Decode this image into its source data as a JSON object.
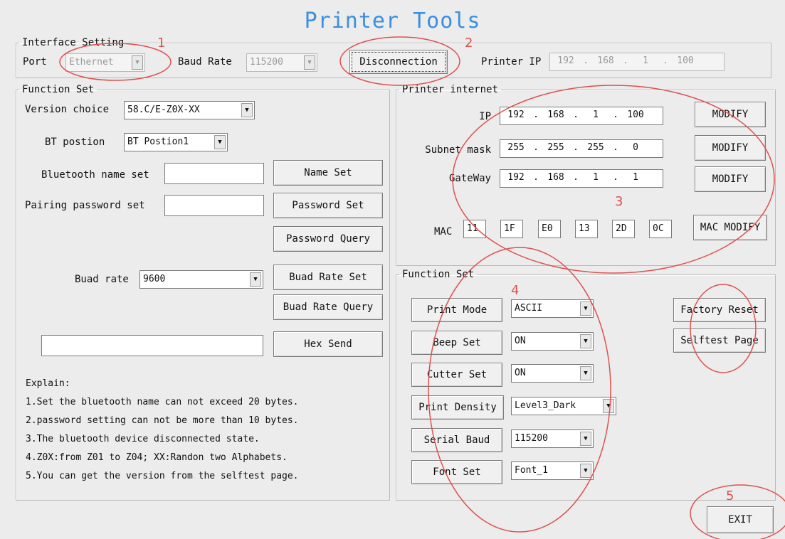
{
  "window_title": "Printer Tools",
  "interface": {
    "legend": "Interface Setting",
    "port_label": "Port",
    "port_value": "Ethernet",
    "baud_label": "Baud Rate",
    "baud_value": "115200",
    "disconnect_label": "Disconnection",
    "printer_ip_label": "Printer IP",
    "printer_ip": [
      "192",
      "168",
      "1",
      "100"
    ]
  },
  "function_left": {
    "legend": "Function Set",
    "version_label": "Version choice",
    "version_value": "58.C/E-Z0X-XX",
    "bt_label": "BT postion",
    "bt_value": "BT Postion1",
    "bt_name_label": "Bluetooth name set",
    "bt_name_value": "",
    "name_set_button": "Name Set",
    "pair_label": "Pairing password set",
    "pair_value": "",
    "password_set_button": "Password Set",
    "password_query_button": "Password Query",
    "buad_label": "Buad rate",
    "buad_value": "9600",
    "buad_set_button": "Buad Rate Set",
    "buad_query_button": "Buad Rate Query",
    "hex_value": "",
    "hex_send_button": "Hex Send",
    "explain_title": "Explain:",
    "explain_lines": [
      "1.Set the bluetooth name can not exceed 20 bytes.",
      "2.password setting can not be more than 10 bytes.",
      "3.The bluetooth device disconnected state.",
      "4.Z0X:from Z01 to Z04; XX:Randon two Alphabets.",
      "5.You can get the version from the selftest page."
    ]
  },
  "printer_internet": {
    "legend": "Printer internet",
    "ip_label": "IP",
    "ip": [
      "192",
      "168",
      "1",
      "100"
    ],
    "subnet_label": "Subnet mask",
    "subnet": [
      "255",
      "255",
      "255",
      "0"
    ],
    "gateway_label": "GateWay",
    "gateway": [
      "192",
      "168",
      "1",
      "1"
    ],
    "modify_button": "MODIFY",
    "mac_label": "MAC",
    "mac": [
      "11",
      "1F",
      "E0",
      "13",
      "2D",
      "0C"
    ],
    "mac_modify_button": "MAC MODIFY"
  },
  "function_right": {
    "legend": "Function Set",
    "print_mode_button": "Print Mode",
    "print_mode_value": "ASCII",
    "beep_button": "Beep Set",
    "beep_value": "ON",
    "cutter_button": "Cutter Set",
    "cutter_value": "ON",
    "density_button": "Print Density",
    "density_value": "Level3_Dark",
    "serial_button": "Serial Baud",
    "serial_value": "115200",
    "font_button": "Font Set",
    "font_value": "Font_1",
    "factory_reset_button": "Factory Reset",
    "selftest_button": "Selftest Page"
  },
  "exit_button": "EXIT",
  "annotations": {
    "color": "#e05050",
    "numbers": [
      "1",
      "2",
      "3",
      "4",
      "5"
    ]
  }
}
